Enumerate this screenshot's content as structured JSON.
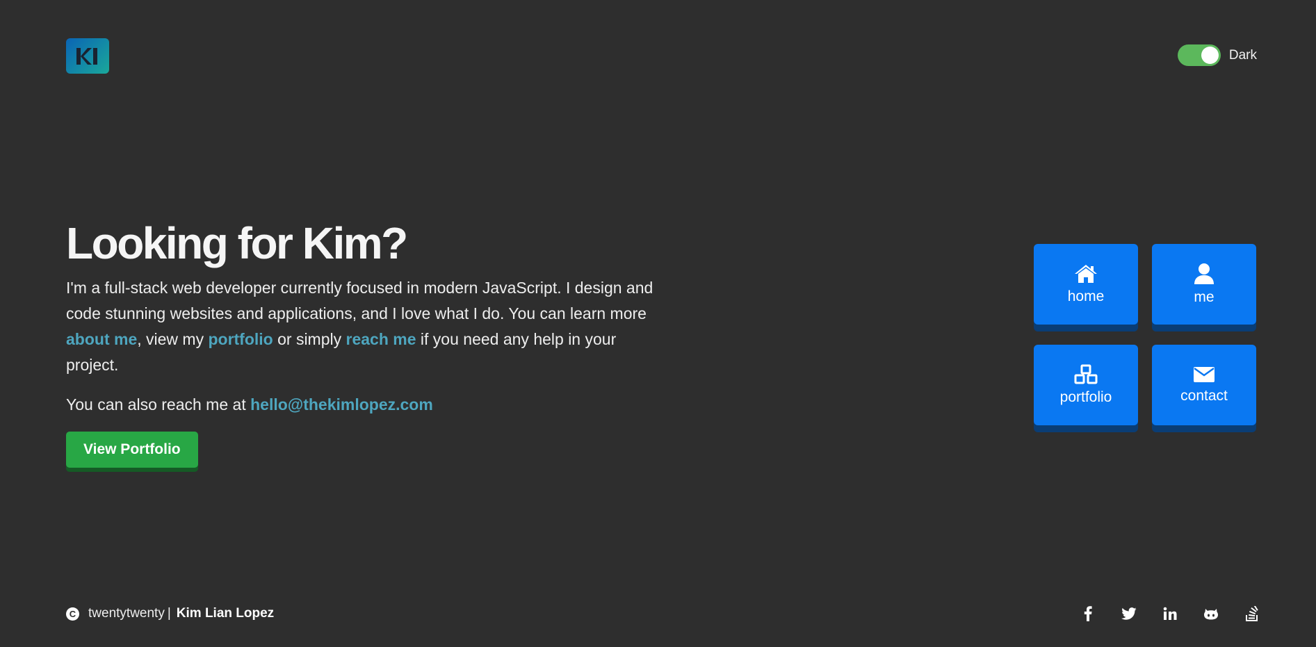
{
  "header": {
    "theme_label": "Dark"
  },
  "hero": {
    "title": "Looking for Kim?",
    "intro_start": "I'm a full-stack web developer currently focused in modern JavaScript. I design and code stunning websites and applications, and I love what I do. You can learn more ",
    "link_about": "about me",
    "intro_mid1": ", view my ",
    "link_portfolio": "portfolio",
    "intro_mid2": " or simply ",
    "link_reach": "reach me",
    "intro_end": " if you need any help in your project.",
    "reach_prefix": "You can also reach me at ",
    "email": "hello@thekimlopez.com",
    "button_label": "View Portfolio"
  },
  "tiles": [
    {
      "label": "home",
      "icon": "home-icon"
    },
    {
      "label": "me",
      "icon": "user-icon"
    },
    {
      "label": "portfolio",
      "icon": "cubes-icon"
    },
    {
      "label": "contact",
      "icon": "envelope-icon"
    }
  ],
  "footer": {
    "copyright_symbol": "C",
    "year_text": "twentytwenty",
    "separator": "|",
    "author": "Kim Lian Lopez"
  },
  "social_icons": [
    "facebook-icon",
    "twitter-icon",
    "linkedin-icon",
    "github-icon",
    "stackoverflow-icon"
  ],
  "colors": {
    "background": "#2e2e2e",
    "accent_blue": "#0a78f2",
    "link_teal": "#4ea6bf",
    "button_green": "#28a745",
    "toggle_green": "#5cb85c"
  }
}
